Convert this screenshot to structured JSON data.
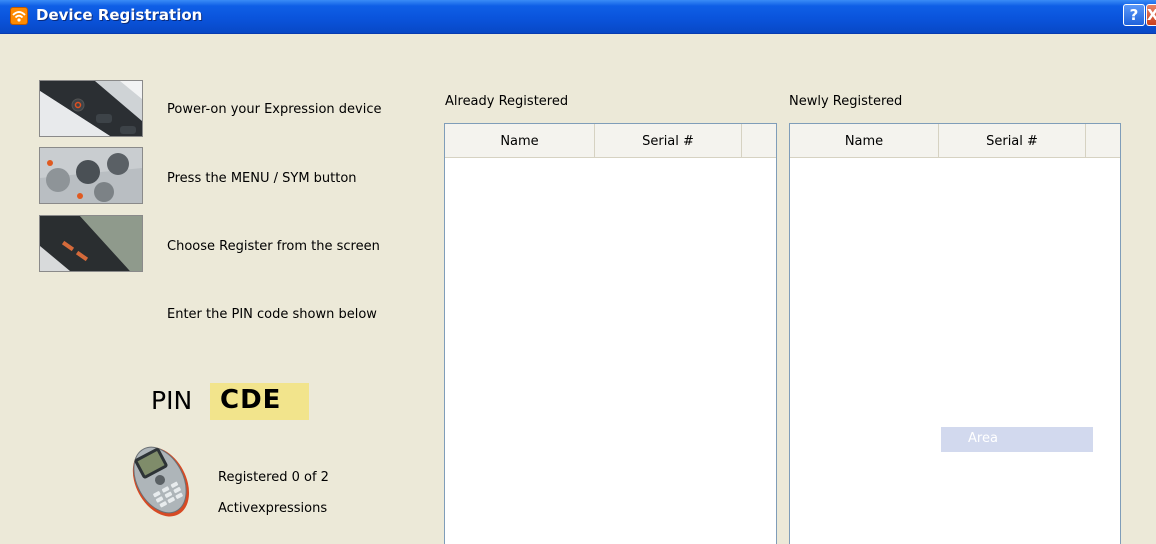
{
  "window": {
    "title": "Device Registration",
    "help_label": "?",
    "close_label": "X"
  },
  "instructions": {
    "step1": "Power-on your Expression device",
    "step2": "Press the MENU / SYM button",
    "step3": "Choose Register from the screen",
    "step4": "Enter the PIN code shown below"
  },
  "pin": {
    "label": "PIN",
    "value": "CDE"
  },
  "status": {
    "line1": "Registered 0 of 2",
    "line2": "Activexpressions"
  },
  "already_registered": {
    "title": "Already Registered",
    "columns": [
      "Name",
      "Serial #"
    ],
    "rows": []
  },
  "newly_registered": {
    "title": "Newly Registered",
    "columns": [
      "Name",
      "Serial #"
    ],
    "rows": [],
    "overlay_label": "Area"
  },
  "colors": {
    "titlebar": "#0a54dc",
    "window_bg": "#ece9d8",
    "pin_highlight": "#f2e48c",
    "overlay": "#d2d9ee"
  },
  "icons": [
    "wifi-icon",
    "help-icon",
    "close-icon",
    "device-power-photo",
    "device-menu-photo",
    "device-screen-photo",
    "handset-icon"
  ]
}
